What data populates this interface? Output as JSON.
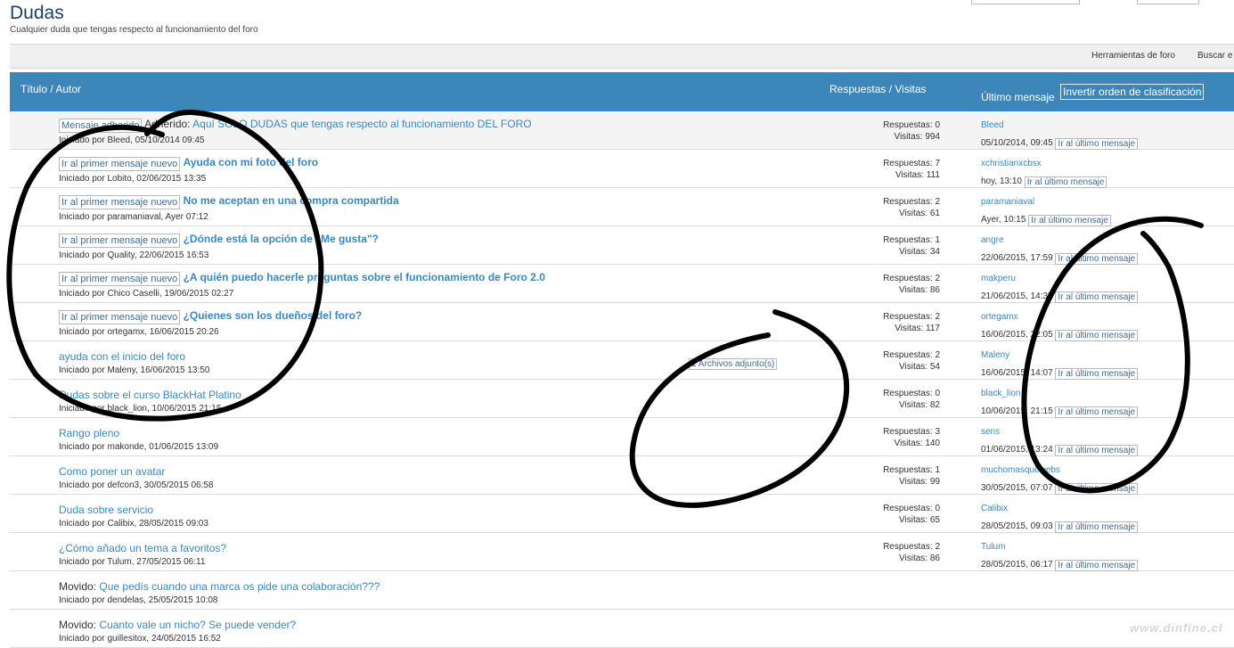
{
  "forum": {
    "title": "Dudas",
    "description": "Cualquier duda que tengas respecto al funcionamiento del foro"
  },
  "toolbar": {
    "tools_label": "Herramientas de foro",
    "search_label": "Buscar e"
  },
  "table_header": {
    "title_author": "Título / Autor",
    "replies_views": "Respuestas / Visitas",
    "last_post": "Último mensaje",
    "sort_alt": "Invertir orden de clasificación"
  },
  "common": {
    "started_by_prefix": "Iniciado por ",
    "replies_prefix": "Respuestas: ",
    "views_prefix": "Visitas: ",
    "first_new_alt": "Ir al primer mensaje nuevo",
    "last_post_alt": "Ir al último mensaje",
    "sticky_icon_alt": "Mensaje adherido",
    "sticky_label": "Adherido:",
    "moved_label": "Movido:"
  },
  "threads": [
    {
      "title": "Aquí SOLO DUDAS que tengas respecto al funcionamiento DEL FORO",
      "author": "Bleed",
      "started": "05/10/2014 09:45",
      "replies": "0",
      "views": "994",
      "last_author": "Bleed",
      "last_date": "05/10/2014, 09:45"
    },
    {
      "title": "Ayuda con mi foto del foro",
      "author": "Lobito",
      "started": "02/06/2015 13:35",
      "replies": "7",
      "views": "111",
      "last_author": "xchristianxcbsx",
      "last_date": "hoy, 13:10"
    },
    {
      "title": "No me aceptan en una compra compartida",
      "author": "paramaniaval",
      "started": "Ayer 07:12",
      "replies": "2",
      "views": "61",
      "last_author": "paramaniaval",
      "last_date": "Ayer, 10:15"
    },
    {
      "title": "¿Dónde está la opción de \"Me gusta\"?",
      "author": "Quality",
      "started": "22/06/2015 16:53",
      "replies": "1",
      "views": "34",
      "last_author": "angre",
      "last_date": "22/06/2015, 17:59"
    },
    {
      "title": "¿A quién puedo hacerle preguntas sobre el funcionamiento de Foro 2.0",
      "author": "Chico Caselli",
      "started": "19/06/2015 02:27",
      "replies": "2",
      "views": "86",
      "last_author": "makperu",
      "last_date": "21/06/2015, 14:37"
    },
    {
      "title": "¿Quienes son los dueños del foro?",
      "author": "ortegamx",
      "started": "16/06/2015 20:26",
      "replies": "2",
      "views": "117",
      "last_author": "ortegamx",
      "last_date": "16/06/2015, 22:05"
    },
    {
      "title": "ayuda con el inicio del foro",
      "author": "Maleny",
      "started": "16/06/2015 13:50",
      "replies": "2",
      "views": "54",
      "last_author": "Maleny",
      "last_date": "16/06/2015, 14:07",
      "attachment": "1 Archivos adjunto(s)"
    },
    {
      "title": "Dudas sobre el curso BlackHat Platino",
      "author": "black_lion",
      "started": "10/06/2015 21:15",
      "replies": "0",
      "views": "82",
      "last_author": "black_lion",
      "last_date": "10/06/2015, 21:15"
    },
    {
      "title": "Rango pleno",
      "author": "makonde",
      "started": "01/06/2015 13:09",
      "replies": "3",
      "views": "140",
      "last_author": "sens",
      "last_date": "01/06/2015, 13:24"
    },
    {
      "title": "Como poner un avatar",
      "author": "defcon3",
      "started": "30/05/2015 06:58",
      "replies": "1",
      "views": "99",
      "last_author": "muchomasquewebs",
      "last_date": "30/05/2015, 07:07"
    },
    {
      "title": "Duda sobre servicio",
      "author": "Calibix",
      "started": "28/05/2015 09:03",
      "replies": "0",
      "views": "65",
      "last_author": "Calibix",
      "last_date": "28/05/2015, 09:03"
    },
    {
      "title": "¿Cómo añado un tema a favoritos?",
      "author": "Tulum",
      "started": "27/05/2015 06:11",
      "replies": "2",
      "views": "86",
      "last_author": "Tulum",
      "last_date": "28/05/2015, 06:17"
    },
    {
      "title": "Que pedís cuando una marca os pide una colaboración???",
      "author": "dendelas",
      "started": "25/05/2015 10:08"
    },
    {
      "title": "Cuanto vale un nicho? Se puede vender?",
      "author": "guillesitox",
      "started": "24/05/2015 16:52"
    }
  ],
  "watermark": "www.dinfine.cl",
  "colors": {
    "header_bg": "#3c86b9",
    "link": "#3a88c0",
    "annotation": "#000000"
  }
}
